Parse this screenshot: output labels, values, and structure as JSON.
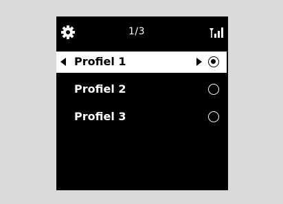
{
  "status": {
    "settings_icon": "gear-icon",
    "page_indicator": "1/3",
    "signal_icon": "antenna-signal-icon"
  },
  "profiles": [
    {
      "label": "Profiel 1",
      "selected": true,
      "checked": true
    },
    {
      "label": "Profiel 2",
      "selected": false,
      "checked": false
    },
    {
      "label": "Profiel 3",
      "selected": false,
      "checked": false
    }
  ],
  "colors": {
    "background": "#dadada",
    "screen": "#000000",
    "highlight": "#ffffff"
  }
}
